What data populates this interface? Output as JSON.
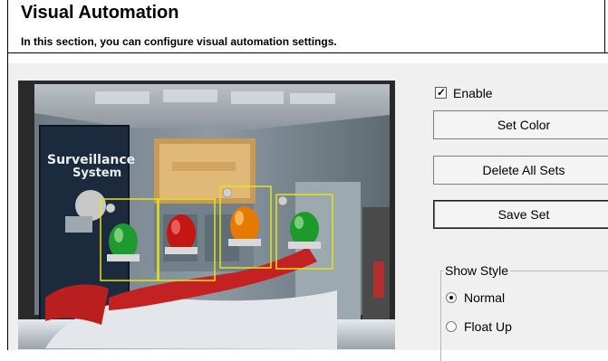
{
  "header": {
    "title": "Visual Automation",
    "subtitle": "In this section, you can configure visual automation settings."
  },
  "video": {
    "poster_text_line1": "Surveillance",
    "poster_text_line2": "System",
    "detection_boxes": 4
  },
  "controls": {
    "enable_label": "Enable",
    "enable_checked": true,
    "set_color_label": "Set Color",
    "delete_all_label": "Delete All Sets",
    "save_set_label": "Save Set"
  },
  "show_style": {
    "label": "Show Style",
    "options": [
      "Normal",
      "Float Up"
    ],
    "selected": "Normal"
  }
}
